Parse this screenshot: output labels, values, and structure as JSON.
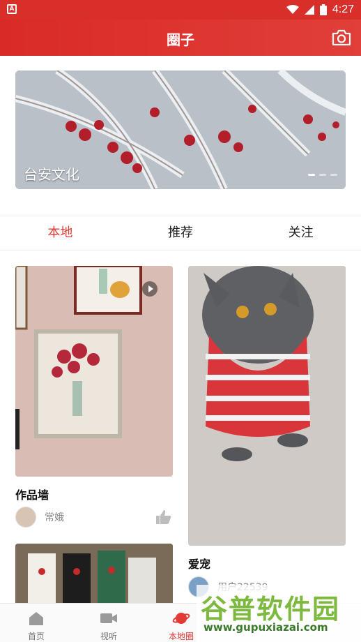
{
  "status_bar": {
    "time": "4:27"
  },
  "header": {
    "title": "圈子"
  },
  "banner": {
    "caption": "台安文化",
    "slides": 3,
    "active_slide": 1
  },
  "tabs": [
    {
      "label": "本地",
      "active": true
    },
    {
      "label": "推荐",
      "active": false
    },
    {
      "label": "关注",
      "active": false
    }
  ],
  "posts": [
    {
      "title": "作品墙",
      "author": "常娥",
      "has_video": true
    },
    {
      "title": "爱宠",
      "author": "用户22539",
      "has_video": false
    },
    {
      "title": "",
      "author": "",
      "has_video": false
    }
  ],
  "bottom_nav": [
    {
      "label": "首页",
      "icon": "home-icon",
      "active": false
    },
    {
      "label": "视听",
      "icon": "video-icon",
      "active": false
    },
    {
      "label": "本地圈",
      "icon": "planet-icon",
      "active": true
    }
  ],
  "watermark": {
    "text": "谷普软件园",
    "url": "www.gupuxiazai.com"
  },
  "colors": {
    "accent": "#e23a35",
    "header": "#d92f2a"
  }
}
